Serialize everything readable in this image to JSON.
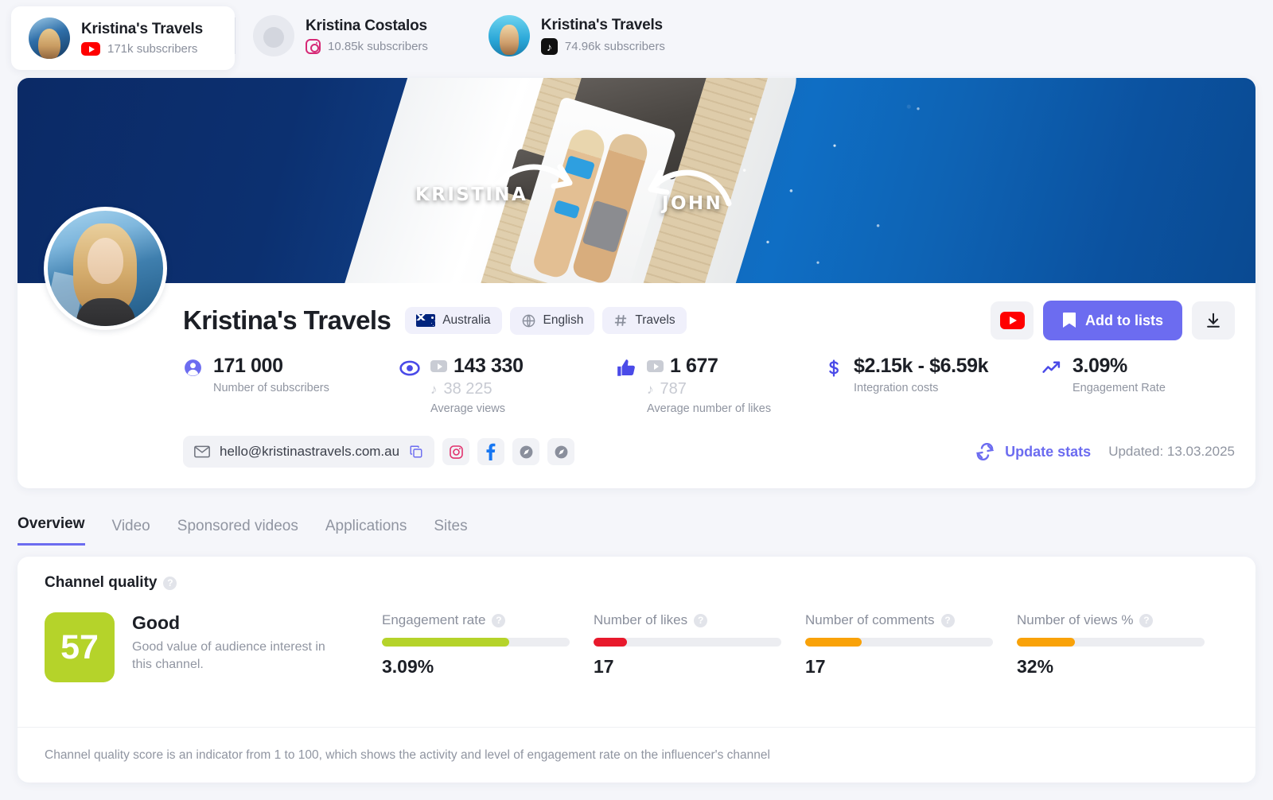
{
  "accounts": [
    {
      "name": "Kristina's Travels",
      "subscribers": "171k subscribers",
      "platform": "youtube",
      "active": true
    },
    {
      "name": "Kristina Costalos",
      "subscribers": "10.85k subscribers",
      "platform": "instagram",
      "active": false
    },
    {
      "name": "Kristina's Travels",
      "subscribers": "74.96k subscribers",
      "platform": "tiktok",
      "active": false
    }
  ],
  "banner": {
    "label_left": "KRISTINA",
    "label_right": "JOHN"
  },
  "profile": {
    "title": "Kristina's Travels",
    "chips": [
      {
        "icon": "flag-au-icon",
        "label": "Australia"
      },
      {
        "icon": "globe-icon",
        "label": "English"
      },
      {
        "icon": "hash-icon",
        "label": "Travels"
      }
    ],
    "actions": {
      "youtube_label": "YouTube",
      "add_to_lists": "Add to lists",
      "download_label": "Download"
    }
  },
  "stats": [
    {
      "value": "171 000",
      "caption": "Number of subscribers",
      "icon": "user-icon",
      "secondary": null,
      "platform_icon": null
    },
    {
      "value": "143 330",
      "platform_icon": "youtube",
      "secondary": "38 225",
      "secondary_icon": "tiktok",
      "caption": "Average views",
      "icon": "eye-icon"
    },
    {
      "value": "1 677",
      "platform_icon": "youtube",
      "secondary": "787",
      "secondary_icon": "tiktok",
      "caption": "Average number of likes",
      "icon": "thumbs-up-icon"
    },
    {
      "value": "$2.15k - $6.59k",
      "caption": "Integration costs",
      "icon": "dollar-icon",
      "secondary": null,
      "platform_icon": null
    },
    {
      "value": "3.09%",
      "caption": "Engagement Rate",
      "icon": "trending-up-icon",
      "secondary": null,
      "platform_icon": null
    }
  ],
  "contacts": {
    "email": "hello@kristinastravels.com.au",
    "socials": [
      "instagram-icon",
      "facebook-icon",
      "compass-icon",
      "compass-icon"
    ],
    "update_label": "Update stats",
    "updated": "Updated: 13.03.2025"
  },
  "tabs": [
    {
      "label": "Overview",
      "active": true
    },
    {
      "label": "Video",
      "active": false
    },
    {
      "label": "Sponsored videos",
      "active": false
    },
    {
      "label": "Applications",
      "active": false
    },
    {
      "label": "Sites",
      "active": false
    }
  ],
  "quality": {
    "title": "Channel quality",
    "score": "57",
    "score_color": "#b5d32a",
    "grade": "Good",
    "description": "Good value of audience interest in this channel.",
    "note": "Channel quality score is an indicator from 1 to 100, which shows the activity and level of engagement rate on the influencer's channel",
    "metrics": [
      {
        "label": "Engagement rate",
        "value": "3.09%",
        "percent": 68,
        "color": "#b5d32a"
      },
      {
        "label": "Number of likes",
        "value": "17",
        "percent": 18,
        "color": "#e8192c"
      },
      {
        "label": "Number of comments",
        "value": "17",
        "percent": 30,
        "color": "#f9a209"
      },
      {
        "label": "Number of views %",
        "value": "32%",
        "percent": 31,
        "color": "#f9a209"
      }
    ]
  }
}
